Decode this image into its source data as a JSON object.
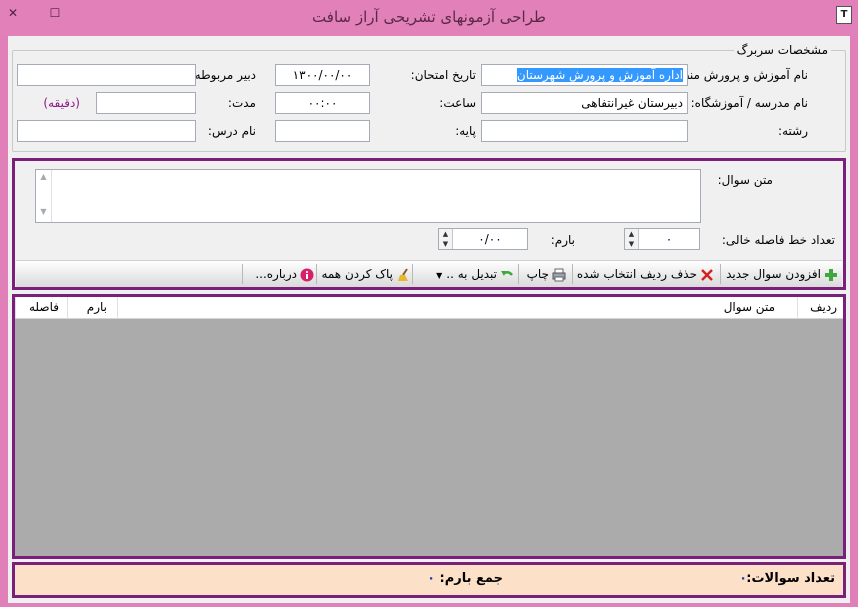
{
  "window": {
    "title": "طراحی آزمونهای تشریحی آراز سافت",
    "close_glyph": "✕",
    "maximize_glyph": "☐",
    "app_icon_glyph": "T"
  },
  "exam_info": {
    "group_title": "مشخصات سربرگ",
    "region_label": "نام آموزش و پرورش منطقه:",
    "region_value": "اداره آموزش و پرورش شهرستان",
    "exam_date_label": "تاریخ امتحان:",
    "exam_date_value": "۱۳۰۰/۰۰/۰۰",
    "teacher_label": "دبیر مربوطه:",
    "teacher_value": "",
    "school_label": "نام مدرسه / آموزشگاه:",
    "school_value": "دبیرستان غیرانتفاهی",
    "time_label": "ساعت:",
    "time_value": "۰۰:۰۰",
    "duration_label": "مدت:",
    "duration_value": "",
    "duration_unit": "(دقیقه)",
    "field_label": "رشته:",
    "field_value": "",
    "grade_label": "پایه:",
    "grade_value": "",
    "course_label": "نام درس:",
    "course_value": ""
  },
  "question": {
    "text_label": "متن سوال:",
    "text_value": "",
    "blank_lines_label": "تعداد خط فاصله خالی:",
    "blank_lines_value": "۰",
    "score_label": "بارم:",
    "score_value": "۰/۰۰"
  },
  "toolbar": {
    "add_label": "افزودن سوال جدید",
    "delete_label": "حذف ردیف انتخاب شده",
    "print_label": "چاپ",
    "convert_label": "تبدیل به ..",
    "clear_label": "پاک کردن همه",
    "about_label": "درباره..."
  },
  "grid": {
    "columns": [
      "ردیف",
      "متن سوال",
      "بارم",
      "فاصله"
    ],
    "rows": []
  },
  "footer": {
    "count_label": "تعداد سوالات:",
    "count_value": "۰",
    "score_sum_label": "جمع بارم:",
    "score_sum_value": "۰"
  },
  "colors": {
    "title_bar": "#e280ba",
    "panel_border": "#7a1f7a",
    "footer_bg": "#fde0c8",
    "grid_bg": "#ababab"
  }
}
